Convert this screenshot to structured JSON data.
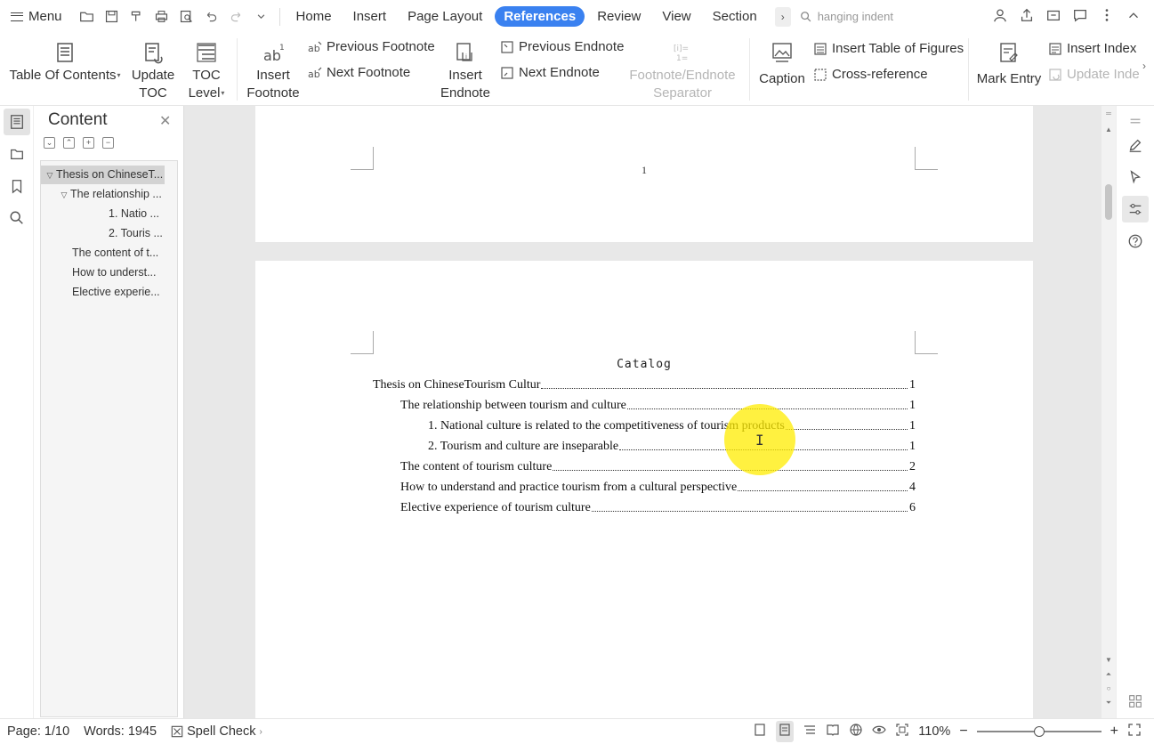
{
  "menubar": {
    "menu_label": "Menu",
    "tabs": [
      {
        "label": "Home"
      },
      {
        "label": "Insert"
      },
      {
        "label": "Page Layout"
      },
      {
        "label": "References",
        "active": true
      },
      {
        "label": "Review"
      },
      {
        "label": "View"
      },
      {
        "label": "Section"
      }
    ],
    "search_text": "hanging indent"
  },
  "ribbon": {
    "table_of_contents": "Table Of Contents",
    "update_toc_line1": "Update",
    "update_toc_line2": "TOC",
    "toc_level_line1": "TOC",
    "toc_level_line2": "Level",
    "insert_footnote_line1": "Insert",
    "insert_footnote_line2": "Footnote",
    "previous_footnote": "Previous Footnote",
    "next_footnote": "Next Footnote",
    "insert_endnote_line1": "Insert",
    "insert_endnote_line2": "Endnote",
    "previous_endnote": "Previous Endnote",
    "next_endnote": "Next Endnote",
    "separator_line1": "Footnote/Endnote",
    "separator_line2": "Separator",
    "caption": "Caption",
    "insert_table_of_figures": "Insert Table of Figures",
    "cross_reference": "Cross-reference",
    "mark_entry": "Mark Entry",
    "insert_index": "Insert Index",
    "update_index": "Update Inde"
  },
  "navpanel": {
    "title": "Content",
    "items": [
      {
        "label": "Thesis on ChineseT..."
      },
      {
        "label": "The relationship ..."
      },
      {
        "label": "1. Natio ..."
      },
      {
        "label": "2. Touris ..."
      },
      {
        "label": "The content of t..."
      },
      {
        "label": "How to underst..."
      },
      {
        "label": "Elective experie..."
      }
    ]
  },
  "document": {
    "prev_page_number": "1",
    "catalog_title": "Catalog",
    "toc": [
      {
        "text": "Thesis on ChineseTourism Cultur",
        "page": "1"
      },
      {
        "text": "The relationship between tourism and culture",
        "page": "1"
      },
      {
        "text": "1. National culture is related to the competitiveness of tourism products",
        "page": "1"
      },
      {
        "text": "2. Tourism and culture are inseparable",
        "page": "1"
      },
      {
        "text": "The content of tourism culture",
        "page": "2"
      },
      {
        "text": "How to understand and practice tourism from a cultural perspective",
        "page": "4"
      },
      {
        "text": "Elective experience of tourism culture",
        "page": "6"
      }
    ]
  },
  "statusbar": {
    "page": "Page: 1/10",
    "words": "Words: 1945",
    "spell_check": "Spell Check",
    "zoom": "110%"
  },
  "colors": {
    "accent": "#3a81f0",
    "highlight": "#ffec00"
  }
}
